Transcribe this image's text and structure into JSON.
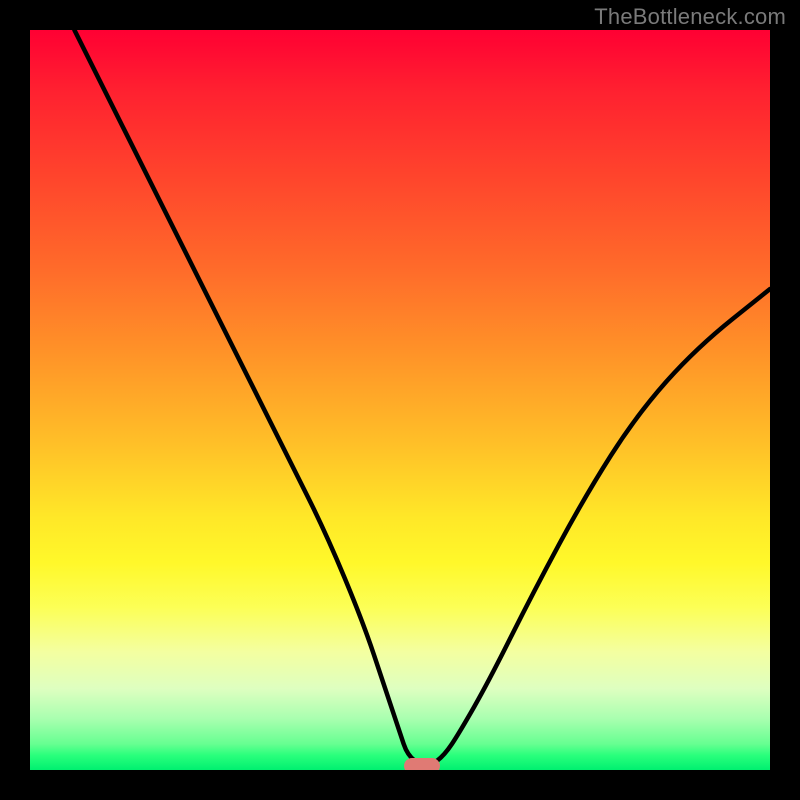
{
  "watermark": "TheBottleneck.com",
  "chart_data": {
    "type": "line",
    "title": "",
    "xlabel": "",
    "ylabel": "",
    "xlim": [
      0,
      100
    ],
    "ylim": [
      0,
      100
    ],
    "grid": false,
    "legend": false,
    "background_gradient_top_color": "#ff0033",
    "background_gradient_bottom_color": "#00f070",
    "series": [
      {
        "name": "curve",
        "color": "#000000",
        "x": [
          6,
          10,
          15,
          20,
          25,
          30,
          35,
          40,
          45,
          48,
          50,
          51,
          53,
          53.5,
          54,
          56,
          58,
          62,
          68,
          75,
          82,
          90,
          100
        ],
        "y": [
          100,
          92,
          82,
          72,
          62,
          52,
          42,
          32,
          20,
          11,
          5,
          2,
          0.5,
          0.2,
          0.5,
          2,
          5,
          12,
          24,
          37,
          48,
          57,
          65
        ]
      }
    ],
    "marker": {
      "x": 53,
      "y": 0,
      "color": "#e07a74"
    }
  }
}
